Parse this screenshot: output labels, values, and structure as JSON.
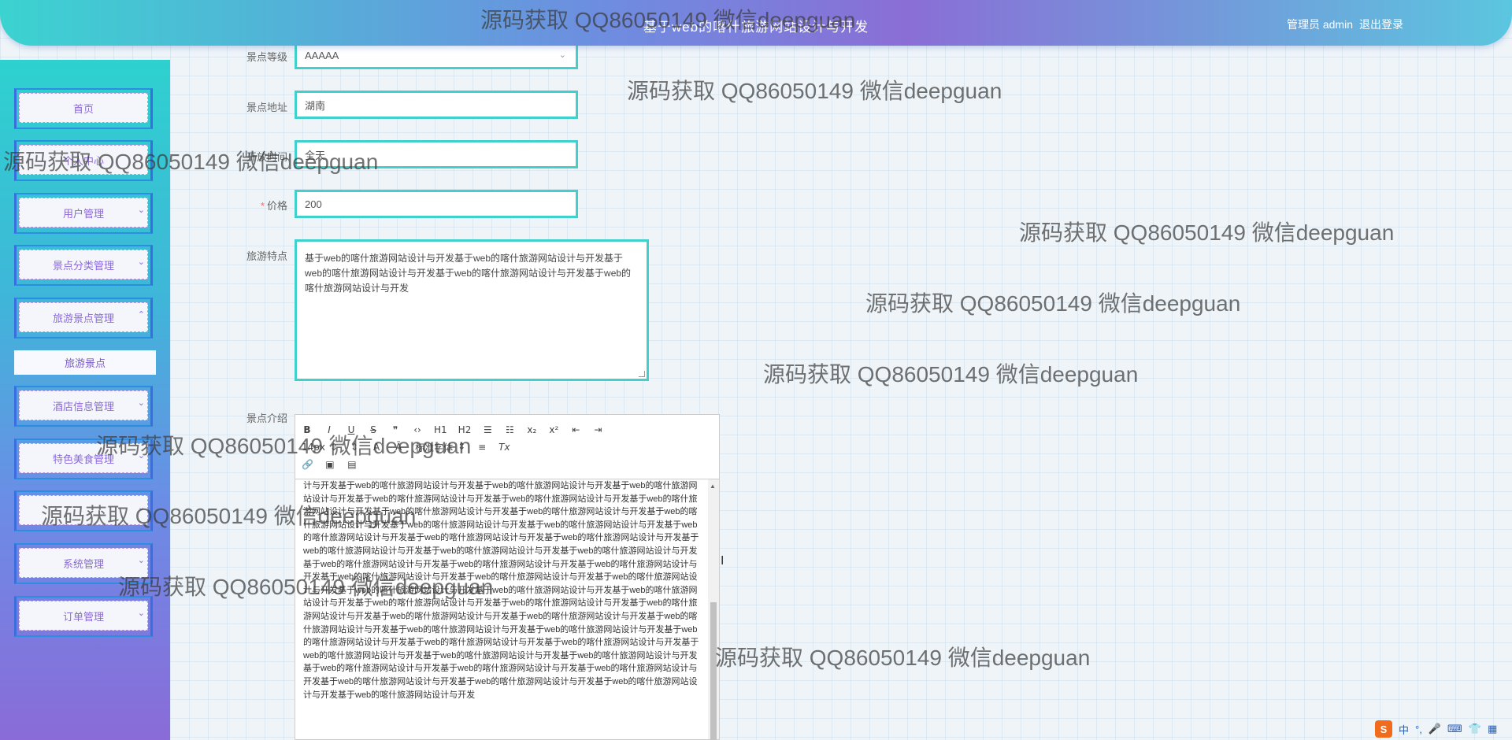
{
  "header": {
    "title": "基于web的喀什旅游网站设计与开发",
    "user": "管理员 admin",
    "logout": "退出登录"
  },
  "sidebar": {
    "items": [
      {
        "label": "首页",
        "chevron": ""
      },
      {
        "label": "个人中心",
        "chevron": ""
      },
      {
        "label": "用户管理",
        "chevron": "⌄"
      },
      {
        "label": "景点分类管理",
        "chevron": "⌄"
      },
      {
        "label": "旅游景点管理",
        "chevron": "⌃"
      },
      {
        "label": "酒店信息管理",
        "chevron": "⌄"
      },
      {
        "label": "特色美食管理",
        "chevron": "⌄"
      },
      {
        "label": "",
        "chevron": "⌄"
      },
      {
        "label": "系统管理",
        "chevron": "⌄"
      },
      {
        "label": "订单管理",
        "chevron": "⌄"
      }
    ],
    "submenu": "旅游景点"
  },
  "form": {
    "level": {
      "label": "景点等级",
      "value": "AAAAA"
    },
    "address": {
      "label": "景点地址",
      "value": "湖南"
    },
    "time": {
      "label": "开放时间",
      "value": "全天"
    },
    "price": {
      "label": "价格",
      "value": "200"
    },
    "feature": {
      "label": "旅游特点",
      "value": "基于web的喀什旅游网站设计与开发基于web的喀什旅游网站设计与开发基于web的喀什旅游网站设计与开发基于web的喀什旅游网站设计与开发基于web的喀什旅游网站设计与开发"
    },
    "intro": {
      "label": "景点介绍",
      "content": "计与开发基于web的喀什旅游网站设计与开发基于web的喀什旅游网站设计与开发基于web的喀什旅游网站设计与开发基于web的喀什旅游网站设计与开发基于web的喀什旅游网站设计与开发基于web的喀什旅游网站设计与开发基于web的喀什旅游网站设计与开发基于web的喀什旅游网站设计与开发基于web的喀什旅游网站设计与开发基于web的喀什旅游网站设计与开发基于web的喀什旅游网站设计与开发基于web的喀什旅游网站设计与开发基于web的喀什旅游网站设计与开发基于web的喀什旅游网站设计与开发基于web的喀什旅游网站设计与开发基于web的喀什旅游网站设计与开发基于web的喀什旅游网站设计与开发基于web的喀什旅游网站设计与开发基于web的喀什旅游网站设计与开发基于web的喀什旅游网站设计与开发基于web的喀什旅游网站设计与开发基于web的喀什旅游网站设计与开发基于web的喀什旅游网站设计与开发基于web的喀什旅游网站设计与开发基于web的喀什旅游网站设计与开发基于web的喀什旅游网站设计与开发基于web的喀什旅游网站设计与开发基于web的喀什旅游网站设计与开发基于web的喀什旅游网站设计与开发基于web的喀什旅游网站设计与开发基于web的喀什旅游网站设计与开发基于web的喀什旅游网站设计与开发基于web的喀什旅游网站设计与开发基于web的喀什旅游网站设计与开发基于web的喀什旅游网站设计与开发基于web的喀什旅游网站设计与开发基于web的喀什旅游网站设计与开发基于web的喀什旅游网站设计与开发基于web的喀什旅游网站设计与开发基于web的喀什旅游网站设计与开发基于web的喀什旅游网站设计与开发基于web的喀什旅游网站设计与开发基于web的喀什旅游网站设计与开发基于web的喀什旅游网站设计与开发基于web的喀什旅游网站设计与开发基于web的喀什旅游网站设计与开发基于web的喀什旅游网站设计与开发"
    }
  },
  "editor": {
    "row1": [
      "B",
      "I",
      "U",
      "S",
      "❞",
      "‹›",
      "H1",
      "H2",
      "☰",
      "☷",
      "x₂",
      "x²",
      "⇤",
      "⇥"
    ],
    "size": "14px",
    "font": "标准字体",
    "row3": [
      "🔗",
      "▣",
      "▤"
    ]
  },
  "watermark": "源码获取 QQ86050149 微信deepguan",
  "ime": {
    "logo": "S",
    "lang": "中"
  }
}
